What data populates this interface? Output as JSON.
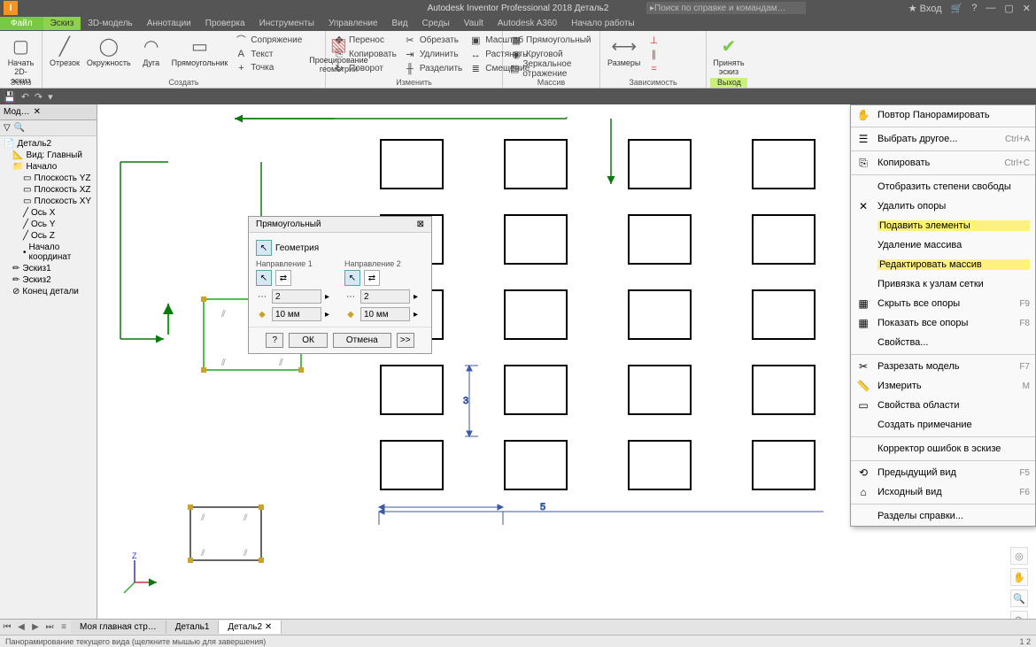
{
  "titlebar": {
    "title": "Autodesk Inventor Professional 2018   Деталь2",
    "search_placeholder": "Поиск по справке и командам…",
    "login": "Вход"
  },
  "menubar": {
    "file": "Файл",
    "tabs": [
      "Эскиз",
      "3D-модель",
      "Аннотации",
      "Проверка",
      "Инструменты",
      "Управление",
      "Вид",
      "Среды",
      "Vault",
      "Autodesk A360",
      "Начало работы"
    ]
  },
  "ribbon": {
    "sketch": {
      "start": "Начать\n2D-эскиз",
      "panel": "Эскиз"
    },
    "draw": {
      "line": "Отрезок",
      "circle": "Окружность",
      "arc": "Дуга",
      "rect": "Прямоугольник",
      "mate": "Сопряжение",
      "text": "Текст",
      "point": "Точка",
      "project": "Проецирование\nгеометрии",
      "panel": "Создать"
    },
    "modify": {
      "move": "Перенос",
      "copy": "Копировать",
      "rotate": "Поворот",
      "trim": "Обрезать",
      "extend": "Удлинить",
      "split": "Разделить",
      "scale": "Масштаб",
      "stretch": "Растянуть",
      "offset": "Смещение",
      "panel": "Изменить"
    },
    "pattern": {
      "rect": "Прямоугольный",
      "circ": "Круговой",
      "mirror": "Зеркальное отражение",
      "panel": "Массив"
    },
    "dim": {
      "dim": "Размеры",
      "panel": "Зависимость"
    },
    "finish": {
      "accept": "Принять\nэскиз",
      "exit": "Выход"
    }
  },
  "browser": {
    "tab": "Мод…",
    "root": "Деталь2",
    "items": [
      "Вид: Главный",
      "Начало",
      "Плоскость YZ",
      "Плоскость XZ",
      "Плоскость XY",
      "Ось X",
      "Ось Y",
      "Ось Z",
      "Начало координат",
      "Эскиз1",
      "Эскиз2",
      "Конец детали"
    ]
  },
  "dialog": {
    "title": "Прямоугольный",
    "geometry": "Геометрия",
    "dir1": "Направление 1",
    "dir2": "Направление 2",
    "count": "2",
    "dist": "10 мм",
    "ok": "ОК",
    "cancel": "Отмена",
    "more": ">>",
    "less": "<<"
  },
  "context": [
    {
      "label": "Повтор Панорамировать",
      "icon": "✋"
    },
    {
      "sep": true
    },
    {
      "label": "Выбрать другое...",
      "shortcut": "Ctrl+A",
      "icon": "☰"
    },
    {
      "sep": true
    },
    {
      "label": "Копировать",
      "shortcut": "Ctrl+C",
      "icon": "⎘"
    },
    {
      "sep": true
    },
    {
      "label": "Отобразить степени свободы"
    },
    {
      "label": "Удалить опоры",
      "icon": "✕"
    },
    {
      "label": "Подавить элементы",
      "hl": true
    },
    {
      "label": "Удаление массива"
    },
    {
      "label": "Редактировать массив",
      "hl": true
    },
    {
      "label": "Привязка к узлам сетки"
    },
    {
      "label": "Скрыть все опоры",
      "shortcut": "F9",
      "icon": "▦"
    },
    {
      "label": "Показать все опоры",
      "shortcut": "F8",
      "icon": "▦"
    },
    {
      "label": "Свойства..."
    },
    {
      "sep": true
    },
    {
      "label": "Разрезать модель",
      "shortcut": "F7",
      "icon": "✂"
    },
    {
      "label": "Измерить",
      "shortcut": "M",
      "icon": "📏"
    },
    {
      "label": "Свойства области",
      "icon": "▭"
    },
    {
      "label": "Создать примечание"
    },
    {
      "sep": true
    },
    {
      "label": "Корректор ошибок в эскизе"
    },
    {
      "sep": true
    },
    {
      "label": "Предыдущий вид",
      "shortcut": "F5",
      "icon": "⟲"
    },
    {
      "label": "Исходный вид",
      "shortcut": "F6",
      "icon": "⌂"
    },
    {
      "sep": true
    },
    {
      "label": "Разделы справки..."
    }
  ],
  "dims": {
    "h": "5",
    "v": "3"
  },
  "btabs": {
    "home": "Моя главная стр…",
    "d1": "Деталь1",
    "d2": "Деталь2"
  },
  "status": {
    "msg": "Панорамирование текущего вида (щелкните мышью для завершения)",
    "right": "1    2"
  }
}
